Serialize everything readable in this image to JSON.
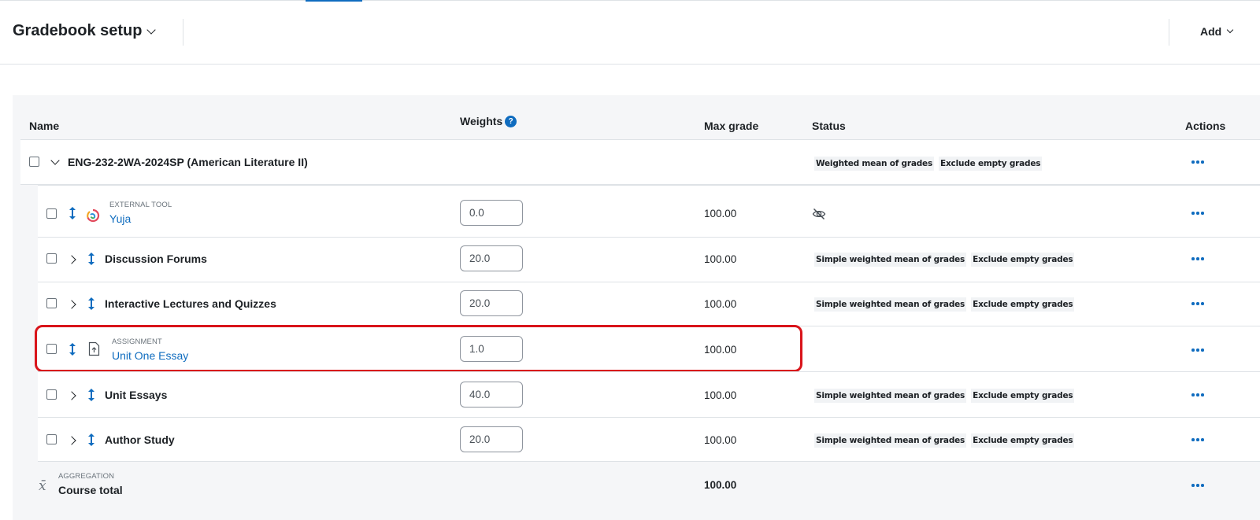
{
  "header": {
    "title": "Gradebook setup",
    "add_label": "Add"
  },
  "columns": {
    "name": "Name",
    "weights": "Weights",
    "weights_help": "?",
    "max_grade": "Max grade",
    "status": "Status",
    "actions": "Actions"
  },
  "category": {
    "title": "ENG-232-2WA-2024SP (American Literature II)",
    "badges": [
      "Weighted mean of grades",
      "Exclude empty grades"
    ]
  },
  "rows": [
    {
      "type_label": "EXTERNAL TOOL",
      "name": "Yuja",
      "weight": "0.0",
      "max_grade": "100.00",
      "status": "hidden-icon"
    },
    {
      "name": "Discussion Forums",
      "weight": "20.0",
      "max_grade": "100.00",
      "badges": [
        "Simple weighted mean of grades",
        "Exclude empty grades"
      ]
    },
    {
      "name": "Interactive Lectures and Quizzes",
      "weight": "20.0",
      "max_grade": "100.00",
      "badges": [
        "Simple weighted mean of grades",
        "Exclude empty grades"
      ]
    },
    {
      "type_label": "ASSIGNMENT",
      "name": "Unit One Essay",
      "weight": "1.0",
      "max_grade": "100.00",
      "highlighted": true
    },
    {
      "name": "Unit Essays",
      "weight": "40.0",
      "max_grade": "100.00",
      "badges": [
        "Simple weighted mean of grades",
        "Exclude empty grades"
      ]
    },
    {
      "name": "Author Study",
      "weight": "20.0",
      "max_grade": "100.00",
      "badges": [
        "Simple weighted mean of grades",
        "Exclude empty grades"
      ]
    }
  ],
  "total": {
    "type_label": "AGGREGATION",
    "name": "Course total",
    "max_grade": "100.00",
    "icon_glyph": "x̄"
  },
  "colors": {
    "accent": "#0f6cbf",
    "highlight": "#d9141a",
    "panel_bg": "#f5f6f8"
  }
}
